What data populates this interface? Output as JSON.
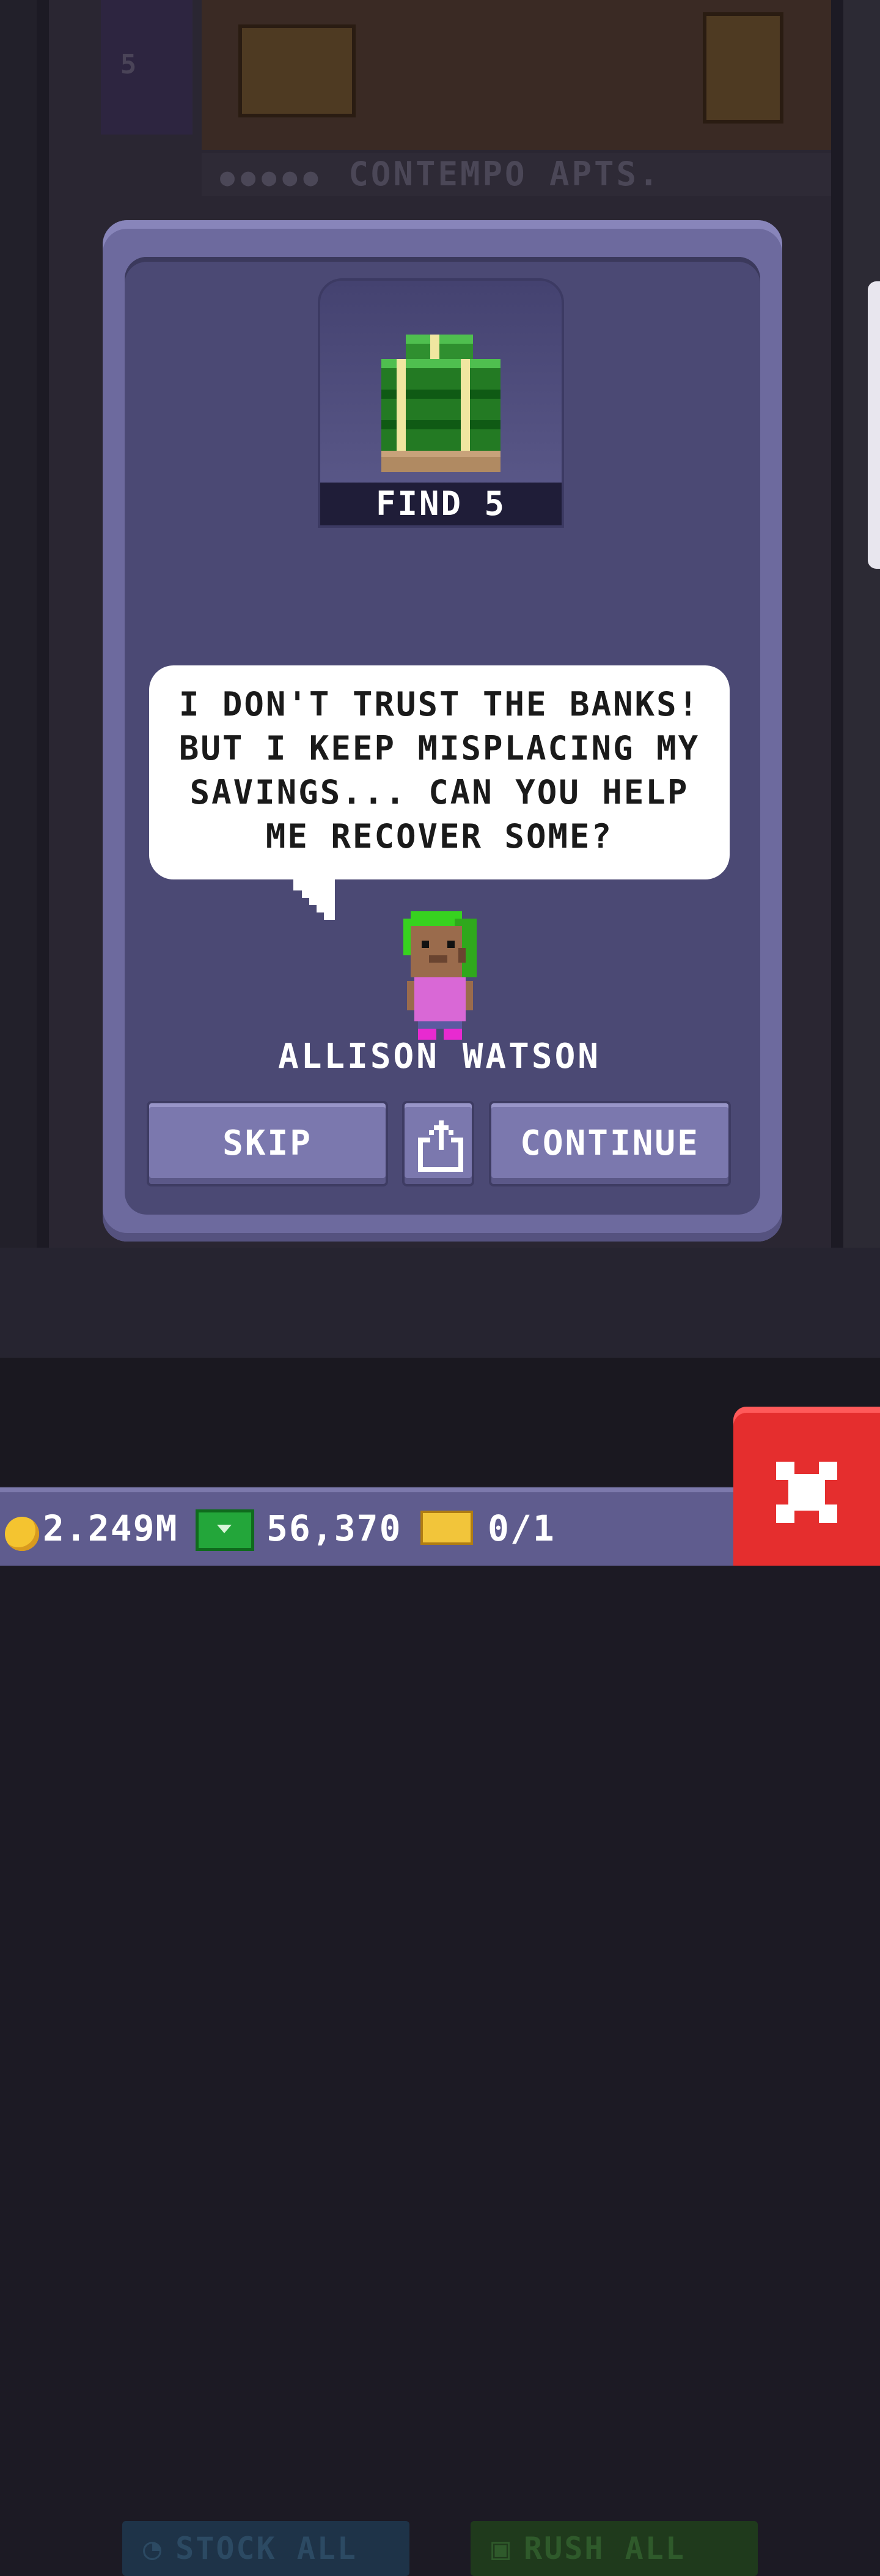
{
  "scene": {
    "floor_number": "5",
    "floor_name": "CONTEMPO APTS.",
    "floor_dots": "●●●●●",
    "stock_all_label": "STOCK ALL",
    "rush_all_label": "RUSH ALL"
  },
  "mission": {
    "goal_label": "FIND 5",
    "item_icon": "cash-stack-icon",
    "speech": "I DON'T TRUST THE BANKS! BUT I KEEP MISPLACING MY SAVINGS... CAN YOU HELP ME RECOVER SOME?",
    "character_name": "ALLISON WATSON"
  },
  "buttons": {
    "skip": "SKIP",
    "share_icon": "share-icon",
    "continue": "CONTINUE"
  },
  "hud": {
    "coins": "2.249M",
    "bux": "56,370",
    "tickets": "0/1"
  },
  "colors": {
    "modal": "#6d6a9e",
    "modal_inner": "#4b4974",
    "button": "#7b78ae",
    "close": "#e52e2e"
  }
}
